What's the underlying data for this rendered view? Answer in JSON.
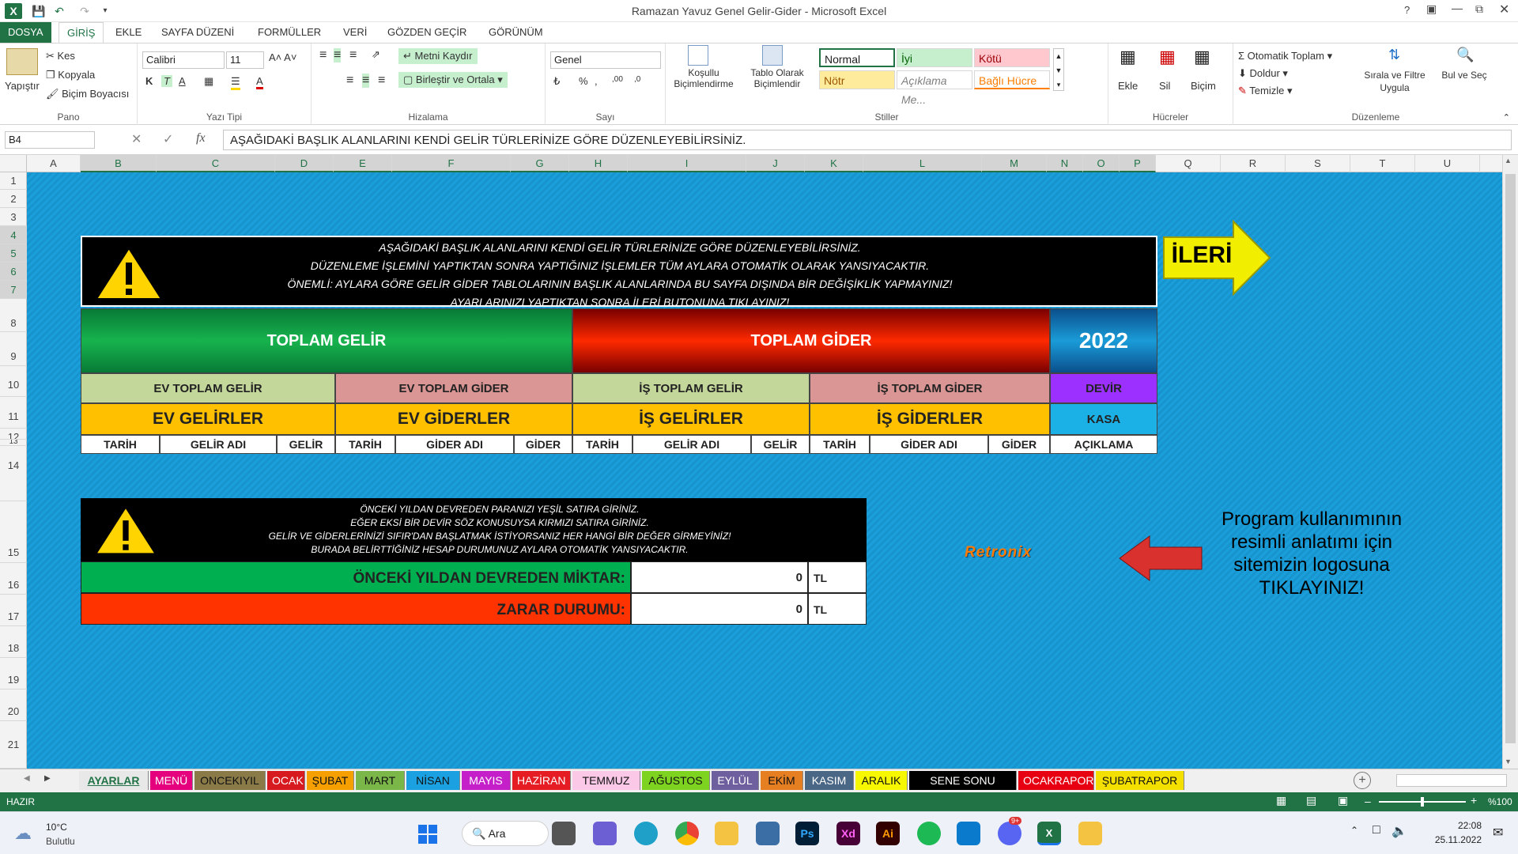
{
  "window": {
    "title": "Ramazan Yavuz Genel Gelir-Gider - Microsoft Excel",
    "help": "?"
  },
  "tabs": [
    "DOSYA",
    "GİRİŞ",
    "EKLE",
    "SAYFA DÜZENİ",
    "FORMÜLLER",
    "VERİ",
    "GÖZDEN GEÇİR",
    "GÖRÜNÜM"
  ],
  "ribbon": {
    "pano": {
      "label": "Pano",
      "paste": "Yapıştır",
      "cut": "Kes",
      "copy": "Kopyala",
      "painter": "Biçim Boyacısı"
    },
    "font": {
      "label": "Yazı Tipi",
      "name": "Calibri",
      "size": "11"
    },
    "align": {
      "label": "Hizalama",
      "wrap": "Metni Kaydır",
      "merge": "Birleştir ve Ortala"
    },
    "number": {
      "label": "Sayı",
      "format": "Genel",
      "pct": "%"
    },
    "styles": {
      "label": "Stiller",
      "cond": "Koşullu Biçimlendirme",
      "table": "Tablo Olarak Biçimlendir",
      "normal": "Normal",
      "iyi": "İyi",
      "kotu": "Kötü",
      "notr": "Nötr",
      "aciklama": "Açıklama Me...",
      "bagli": "Bağlı Hücre"
    },
    "cells": {
      "label": "Hücreler",
      "insert": "Ekle",
      "delete": "Sil",
      "format": "Biçim"
    },
    "edit": {
      "label": "Düzenleme",
      "autosum": "Otomatik Toplam",
      "fill": "Doldur",
      "clear": "Temizle",
      "sort": "Sırala ve Filtre Uygula",
      "find": "Bul ve Seç"
    }
  },
  "formula": {
    "namebox": "B4",
    "fx": "fx",
    "content": "AŞAĞIDAKİ BAŞLIK ALANLARINI KENDİ GELİR TÜRLERİNİZE GÖRE DÜZENLEYEBİLİRSİNİZ."
  },
  "columns": [
    "A",
    "B",
    "C",
    "D",
    "E",
    "F",
    "G",
    "H",
    "I",
    "J",
    "K",
    "L",
    "M",
    "N",
    "O",
    "P",
    "Q",
    "R",
    "S",
    "T",
    "U"
  ],
  "rows": [
    "1",
    "2",
    "3",
    "4",
    "5",
    "6",
    "7",
    "8",
    "9",
    "10",
    "11",
    "12",
    "13",
    "14",
    "15",
    "16",
    "17",
    "18",
    "19",
    "20",
    "21"
  ],
  "notice1": [
    "AŞAĞIDAKİ BAŞLIK ALANLARINI KENDİ GELİR TÜRLERİNİZE GÖRE DÜZENLEYEBİLİRSİNİZ.",
    "DÜZENLEME İŞLEMİNİ YAPTIKTAN SONRA YAPTIĞINIZ İŞLEMLER TÜM AYLARA OTOMATİK OLARAK YANSIYACAKTIR.",
    "ÖNEMLİ: AYLARA GÖRE GELİR GİDER TABLOLARININ BAŞLIK ALANLARINDA BU SAYFA DIŞINDA BİR DEĞİŞİKLİK YAPMAYINIZ!",
    "AYARLARINIZI YAPTIKTAN SONRA İLERİ BUTONUNA TIKLAYINIZ!"
  ],
  "next_button": "İLERİ",
  "summary": {
    "gelir": "TOPLAM GELİR",
    "gider": "TOPLAM GİDER",
    "year": "2022",
    "ev_gelir": "EV TOPLAM GELİR",
    "ev_gider": "EV TOPLAM GİDER",
    "is_gelir": "İŞ TOPLAM GELİR",
    "is_gider": "İŞ TOPLAM GİDER",
    "devir": "DEVİR",
    "ev_gelirler": "EV GELİRLER",
    "ev_giderler": "EV GİDERLER",
    "is_gelirler": "İŞ GELİRLER",
    "is_giderler": "İŞ GİDERLER",
    "kasa": "KASA"
  },
  "subheaders": [
    "TARİH",
    "GELİR ADI",
    "GELİR",
    "TARİH",
    "GİDER ADI",
    "GİDER",
    "TARİH",
    "GELİR ADI",
    "GELİR",
    "TARİH",
    "GİDER ADI",
    "GİDER",
    "AÇIKLAMA"
  ],
  "notice2": [
    "ÖNCEKİ YILDAN DEVREDEN PARANIZI YEŞİL SATIRA GİRİNİZ.",
    "EĞER EKSİ BİR DEVİR SÖZ KONUSUYSA KIRMIZI SATIRA GİRİNİZ.",
    "GELİR VE GİDERLERİNİZİ SIFIR'DAN BAŞLATMAK İSTİYORSANIZ HER HANGİ BİR DEĞER GİRMEYİNİZ!",
    "BURADA BELİRTTİĞİNİZ HESAP DURUMUNUZ AYLARA OTOMATİK YANSIYACAKTIR."
  ],
  "carry": {
    "label": "ÖNCEKİ YILDAN DEVREDEN MİKTAR:",
    "value": "0",
    "unit": "TL"
  },
  "loss": {
    "label": "ZARAR DURUMU:",
    "value": "0",
    "unit": "TL"
  },
  "logo": "Retronix",
  "help_text": [
    "Program kullanımının",
    "resimli anlatımı için",
    "sitemizin logosuna",
    "TIKLAYINIZ!"
  ],
  "sheet_tabs": [
    {
      "name": "AYARLAR",
      "bg": "#e8e8e8",
      "fg": "#217346"
    },
    {
      "name": "MENÜ",
      "bg": "#e5007e",
      "fg": "#fff"
    },
    {
      "name": "ONCEKIYIL",
      "bg": "#8a7a48",
      "fg": "#111"
    },
    {
      "name": "OCAK",
      "bg": "#d71920",
      "fg": "#fff"
    },
    {
      "name": "ŞUBAT",
      "bg": "#f5a000",
      "fg": "#111"
    },
    {
      "name": "MART",
      "bg": "#7ab648",
      "fg": "#111"
    },
    {
      "name": "NİSAN",
      "bg": "#1ba1e2",
      "fg": "#111"
    },
    {
      "name": "MAYIS",
      "bg": "#c41fc9",
      "fg": "#fff"
    },
    {
      "name": "HAZİRAN",
      "bg": "#e51c23",
      "fg": "#fff"
    },
    {
      "name": "TEMMUZ",
      "bg": "#fcc8e8",
      "fg": "#111"
    },
    {
      "name": "AĞUSTOS",
      "bg": "#7ed321",
      "fg": "#111"
    },
    {
      "name": "EYLÜL",
      "bg": "#6e5f9e",
      "fg": "#fff"
    },
    {
      "name": "EKİM",
      "bg": "#e67e22",
      "fg": "#111"
    },
    {
      "name": "KASIM",
      "bg": "#4a6785",
      "fg": "#fff"
    },
    {
      "name": "ARALIK",
      "bg": "#f7f700",
      "fg": "#111"
    },
    {
      "name": "SENE SONU RAPOR",
      "bg": "#000000",
      "fg": "#fff"
    },
    {
      "name": "OCAKRAPOR",
      "bg": "#e60012",
      "fg": "#fff"
    },
    {
      "name": "ŞUBATRAPOR",
      "bg": "#f4e000",
      "fg": "#111"
    }
  ],
  "status": {
    "state": "HAZIR",
    "zoom": "%100"
  },
  "taskbar": {
    "temp": "10°C",
    "weather": "Bulutlu",
    "search": "Ara",
    "time": "22:08",
    "date": "25.11.2022",
    "badge": "9+"
  }
}
